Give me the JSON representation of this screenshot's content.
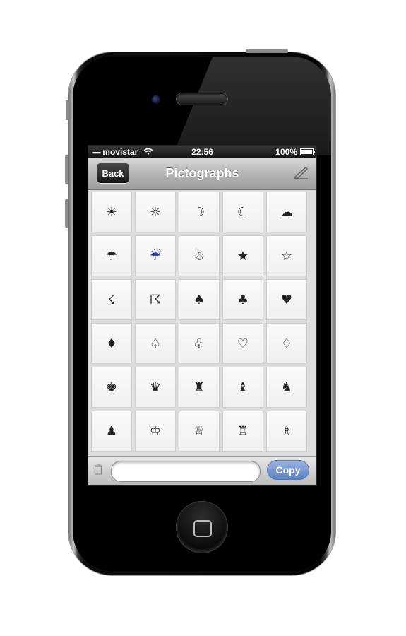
{
  "status": {
    "carrier": "movistar",
    "time": "22:56",
    "battery_percent": "100%"
  },
  "navbar": {
    "back_label": "Back",
    "title": "Pictographs"
  },
  "grid": {
    "rows": [
      [
        "☀",
        "☼",
        "☽",
        "☾",
        "☁"
      ],
      [
        "☂",
        "☔",
        "☃",
        "★",
        "☆"
      ],
      [
        "☇",
        "☈",
        "♠",
        "♣",
        "♥"
      ],
      [
        "♦",
        "♤",
        "♧",
        "♡",
        "♢"
      ],
      [
        "♚",
        "♛",
        "♜",
        "♝",
        "♞"
      ],
      [
        "♟",
        "♔",
        "♕",
        "♖",
        "♗"
      ]
    ]
  },
  "bottombar": {
    "text_value": "",
    "copy_label": "Copy"
  },
  "icons": {
    "wifi": "wifi-icon",
    "battery": "battery-icon",
    "compose": "compose-icon",
    "trash": "trash-icon"
  }
}
